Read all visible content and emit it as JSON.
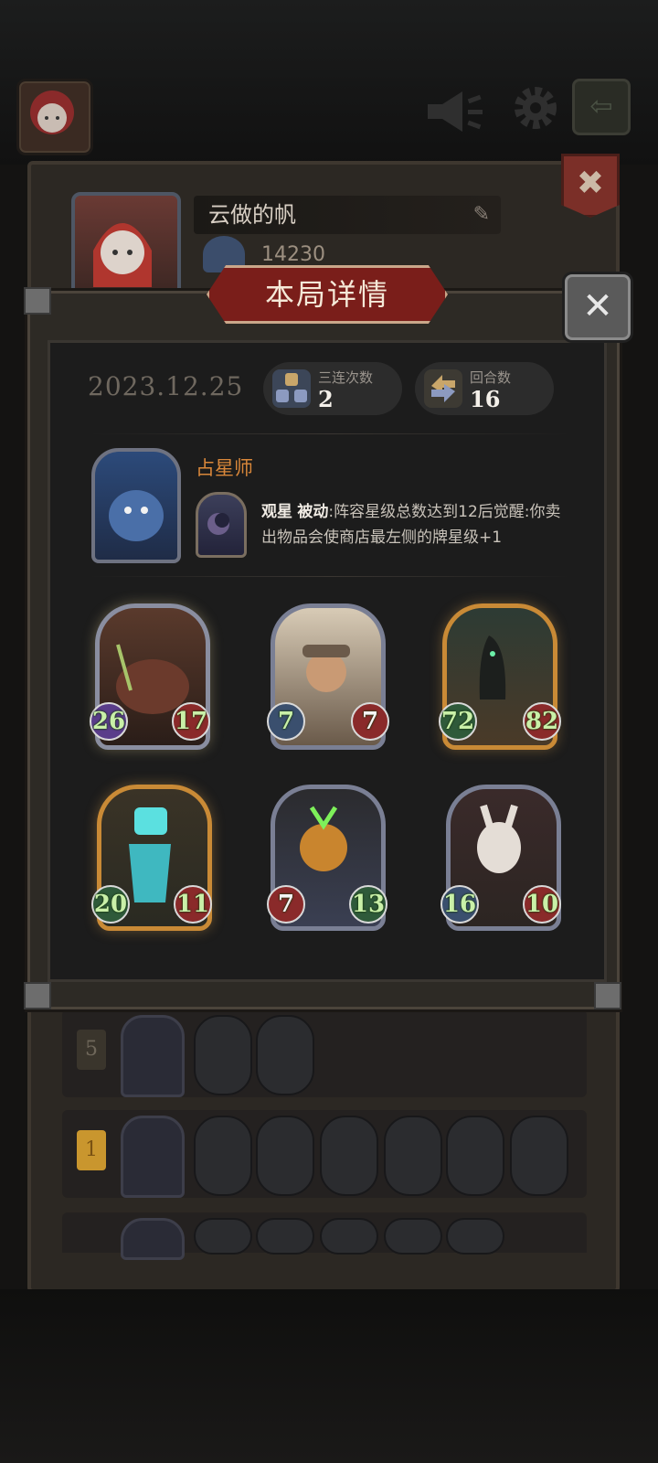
{
  "profile": {
    "name": "云做的帆",
    "score": "14230"
  },
  "modal": {
    "title": "本局详情",
    "date": "2023.12.25",
    "stats": [
      {
        "label": "三连次数",
        "value": "2"
      },
      {
        "label": "回合数",
        "value": "16"
      }
    ],
    "hero": {
      "name": "占星师",
      "skill_name": "观星",
      "skill_type": "被动",
      "skill_desc": ":阵容星级总数达到12后觉醒:你卖出物品会使商店最左侧的牌星级+1"
    },
    "units": [
      {
        "atk": "26",
        "hp": "17",
        "name": "boar-unit"
      },
      {
        "atk": "7",
        "hp": "7",
        "name": "scholar-unit"
      },
      {
        "atk": "72",
        "hp": "82",
        "name": "reaper-unit"
      },
      {
        "atk": "20",
        "hp": "11",
        "name": "ghost-chef-unit"
      },
      {
        "atk": "7",
        "hp": "13",
        "name": "pumpkin-unit"
      },
      {
        "atk": "16",
        "hp": "10",
        "name": "rabbit-mask-unit"
      }
    ]
  },
  "history": [
    {
      "rank": "5",
      "unit_count": 2
    },
    {
      "rank": "1",
      "unit_count": 6
    }
  ],
  "colors": {
    "accent_red": "#7a1e1a",
    "hero_name": "#d9873a",
    "stat_number": "#c9f0a8"
  }
}
